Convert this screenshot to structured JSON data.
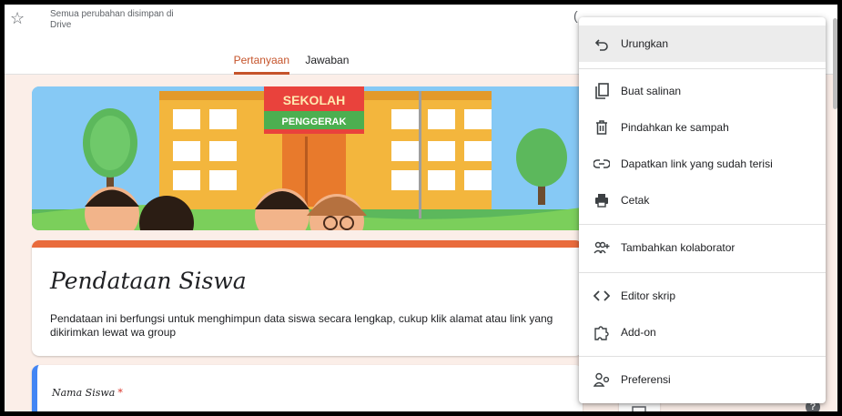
{
  "header": {
    "saved_status": "Semua perubahan disimpan di Drive",
    "tabs": [
      {
        "label": "Pertanyaan",
        "active": true
      },
      {
        "label": "Jawaban",
        "active": false
      }
    ]
  },
  "banner": {
    "sign_line1": "SEKOLAH",
    "sign_line2": "PENGGERAK"
  },
  "form": {
    "title": "Pendataan Siswa",
    "description": "Pendataan ini berfungsi untuk menghimpun data siswa secara lengkap, cukup klik alamat atau link yang dikirimkan lewat wa group",
    "accent_color": "#e96b3c"
  },
  "question": {
    "label": "Nama Siswa",
    "required_mark": "*"
  },
  "menu": {
    "items": [
      {
        "label": "Urungkan",
        "icon": "undo-icon"
      },
      {
        "label": "Buat salinan",
        "icon": "copy-icon"
      },
      {
        "label": "Pindahkan ke sampah",
        "icon": "trash-icon"
      },
      {
        "label": "Dapatkan link yang sudah terisi",
        "icon": "link-icon"
      },
      {
        "label": "Cetak",
        "icon": "print-icon"
      },
      {
        "label": "Tambahkan kolaborator",
        "icon": "add-collaborator-icon"
      },
      {
        "label": "Editor skrip",
        "icon": "code-icon"
      },
      {
        "label": "Add-on",
        "icon": "puzzle-icon"
      },
      {
        "label": "Preferensi",
        "icon": "preferences-icon"
      }
    ]
  },
  "help": {
    "symbol": "?"
  }
}
